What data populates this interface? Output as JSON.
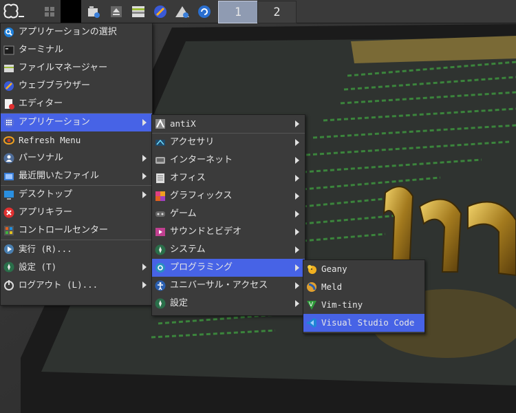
{
  "taskbar": {
    "workspaces": [
      "1",
      "2"
    ],
    "launchers": [
      "menu-icon",
      "show-desktop-icon",
      "blank-icon",
      "file-manager-icon",
      "eject-icon",
      "screen-icon",
      "browser-icon",
      "mount-icon",
      "update-icon"
    ]
  },
  "main_menu": {
    "items": [
      {
        "label": "アプリケーションの選択",
        "icon": "app-select-icon"
      },
      {
        "label": "ターミナル",
        "icon": "terminal-icon"
      },
      {
        "label": "ファイルマネージャー",
        "icon": "file-manager-icon"
      },
      {
        "label": "ウェブブラウザー",
        "icon": "web-browser-icon"
      },
      {
        "label": "エディター",
        "icon": "editor-icon"
      },
      {
        "label": "アプリケーション",
        "icon": "applications-icon",
        "submenu": true,
        "selected": true
      },
      {
        "label": "Refresh Menu",
        "icon": "refresh-icon"
      },
      {
        "label": "パーソナル",
        "icon": "personal-icon",
        "submenu": true
      },
      {
        "label": "最近開いたファイル",
        "icon": "recent-files-icon",
        "submenu": true
      },
      {
        "label": "デスクトップ",
        "icon": "desktop-icon",
        "submenu": true
      },
      {
        "label": "アプリキラー",
        "icon": "app-killer-icon"
      },
      {
        "label": "コントロールセンター",
        "icon": "control-center-icon"
      },
      {
        "label": "実行 (R)...",
        "icon": "run-icon"
      },
      {
        "label": "設定 (T)",
        "icon": "settings-icon",
        "submenu": true
      },
      {
        "label": "ログアウト (L)...",
        "icon": "logout-icon",
        "submenu": true
      }
    ]
  },
  "apps_menu": {
    "items": [
      {
        "label": "antiX",
        "icon": "antix-icon"
      },
      {
        "label": "アクセサリ",
        "icon": "accessories-icon"
      },
      {
        "label": "インターネット",
        "icon": "internet-icon"
      },
      {
        "label": "オフィス",
        "icon": "office-icon"
      },
      {
        "label": "グラフィックス",
        "icon": "graphics-icon"
      },
      {
        "label": "ゲーム",
        "icon": "games-icon"
      },
      {
        "label": "サウンドとビデオ",
        "icon": "sound-video-icon"
      },
      {
        "label": "システム",
        "icon": "system-icon"
      },
      {
        "label": "プログラミング",
        "icon": "programming-icon",
        "selected": true
      },
      {
        "label": "ユニバーサル・アクセス",
        "icon": "accessibility-icon"
      },
      {
        "label": "設定",
        "icon": "settings-icon"
      }
    ]
  },
  "prog_menu": {
    "items": [
      {
        "label": "Geany",
        "icon": "geany-icon"
      },
      {
        "label": "Meld",
        "icon": "meld-icon"
      },
      {
        "label": "Vim-tiny",
        "icon": "vim-icon"
      },
      {
        "label": "Visual Studio Code",
        "icon": "vscode-icon",
        "selected": true
      }
    ]
  },
  "colors": {
    "selection": "#4763e6",
    "menu_bg": "#3b3b3b",
    "taskbar_bg": "#3a3a3a"
  }
}
